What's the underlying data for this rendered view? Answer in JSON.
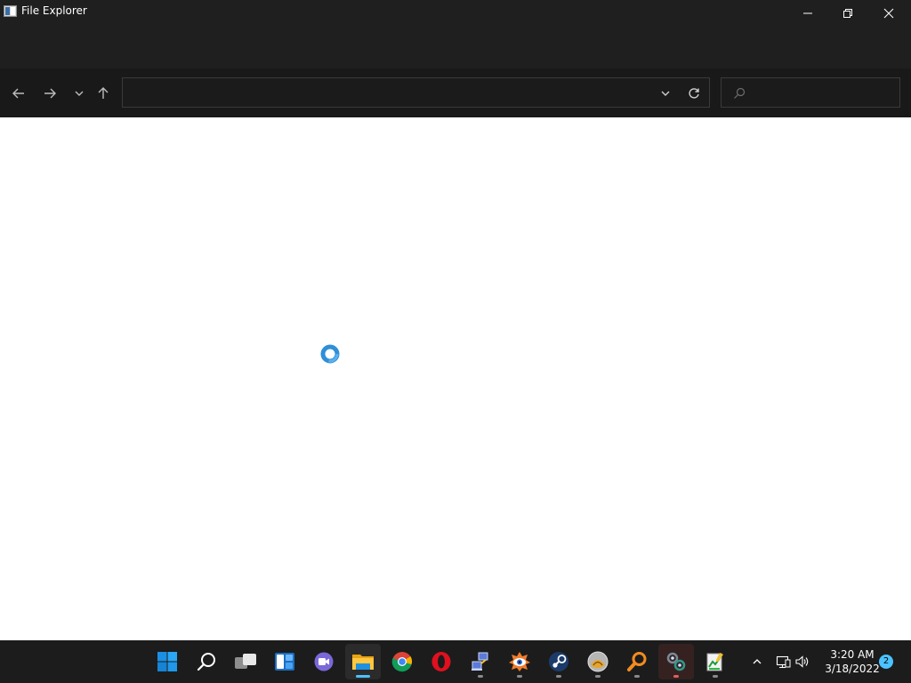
{
  "window": {
    "title": "File Explorer",
    "minimize_icon": "minimize-icon",
    "maximize_icon": "restore-icon",
    "close_icon": "close-icon"
  },
  "navigation": {
    "back_icon": "arrow-left-icon",
    "forward_icon": "arrow-right-icon",
    "recent_icon": "chevron-down-icon",
    "up_icon": "arrow-up-icon"
  },
  "address_bar": {
    "value": "",
    "dropdown_icon": "chevron-down-icon",
    "refresh_icon": "refresh-icon"
  },
  "search": {
    "placeholder": "",
    "icon": "search-icon"
  },
  "content": {
    "state": "loading",
    "cursor_icon": "busy-cursor-icon"
  },
  "taskbar": {
    "items": [
      {
        "name": "start",
        "icon": "windows-start-icon"
      },
      {
        "name": "search",
        "icon": "search-icon"
      },
      {
        "name": "task-view",
        "icon": "task-view-icon"
      },
      {
        "name": "widgets",
        "icon": "widgets-icon"
      },
      {
        "name": "chat",
        "icon": "teams-chat-icon"
      },
      {
        "name": "file-explorer",
        "icon": "folder-icon",
        "active": true
      },
      {
        "name": "chrome",
        "icon": "chrome-icon"
      },
      {
        "name": "opera",
        "icon": "opera-icon"
      },
      {
        "name": "network-app",
        "icon": "network-app-icon"
      },
      {
        "name": "eye-app",
        "icon": "eye-app-icon"
      },
      {
        "name": "steam",
        "icon": "steam-icon"
      },
      {
        "name": "disc-app",
        "icon": "disc-app-icon"
      },
      {
        "name": "magnifier-app",
        "icon": "magnifier-app-icon"
      },
      {
        "name": "chain-app",
        "icon": "chain-app-icon"
      },
      {
        "name": "notepad-app",
        "icon": "notepad-chart-icon"
      }
    ],
    "tray": {
      "chevron_icon": "chevron-up-icon",
      "network_icon": "network-icon",
      "volume_icon": "volume-icon",
      "time": "3:20 AM",
      "date": "3/18/2022",
      "notification_count": "2"
    }
  },
  "colors": {
    "titlebar": "#1f1f1f",
    "navbar": "#191919",
    "taskbar": "#1c1c1c",
    "accent": "#4cc2ff",
    "content": "#ffffff"
  }
}
